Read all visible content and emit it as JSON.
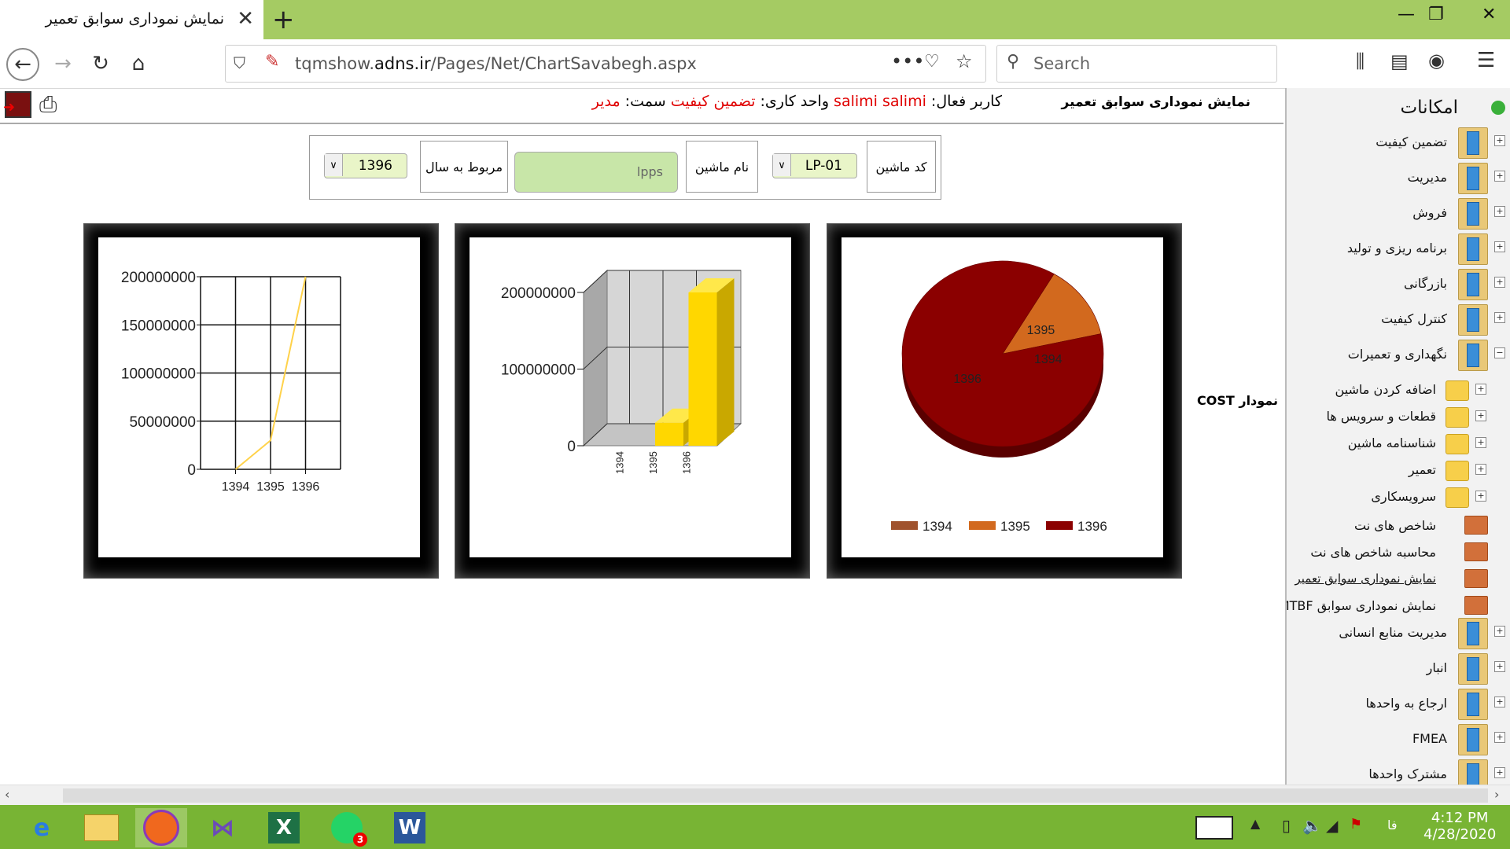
{
  "browser": {
    "tab_title": "نمایش نموداری سوابق تعمیر",
    "url_prefix": "tqmshow.",
    "url_domain": "adns.ir",
    "url_path": "/Pages/Net/ChartSavabegh.aspx",
    "search_placeholder": "Search"
  },
  "header": {
    "page_title": "نمایش نموداری سوابق تعمیر",
    "user_label": "کاربر فعال:",
    "user_value": "salimi salimi",
    "unit_label": "واحد کاری:",
    "unit_value": "تضمین کیفیت",
    "role_label": "سمت:",
    "role_value": "مدیر"
  },
  "filter": {
    "machine_code_label": "کد ماشین",
    "machine_code_value": "LP-01",
    "machine_name_label": "نام ماشین",
    "machine_name_value": "lpps",
    "year_label": "مربوط به سال",
    "year_value": "1396"
  },
  "chart_title": "نمودار COST",
  "sidebar": {
    "title": "امکانات",
    "items": [
      {
        "label": "تضمین کیفیت",
        "level": 0,
        "expander": "+"
      },
      {
        "label": "مدیریت",
        "level": 0,
        "expander": "+"
      },
      {
        "label": "فروش",
        "level": 0,
        "expander": "+"
      },
      {
        "label": "برنامه ریزی و تولید",
        "level": 0,
        "expander": "+"
      },
      {
        "label": "بازرگانی",
        "level": 0,
        "expander": "+"
      },
      {
        "label": "کنترل کیفیت",
        "level": 0,
        "expander": "+"
      },
      {
        "label": "نگهداری و تعمیرات",
        "level": 0,
        "expander": "−"
      },
      {
        "label": "اضافه کردن ماشین",
        "level": 1,
        "expander": "+"
      },
      {
        "label": "قطعات و سرویس ها",
        "level": 1,
        "expander": "+"
      },
      {
        "label": "شناسنامه ماشین",
        "level": 1,
        "expander": "+"
      },
      {
        "label": "تعمیر",
        "level": 1,
        "expander": "+"
      },
      {
        "label": "سرویسکاری",
        "level": 1,
        "expander": "+"
      },
      {
        "label": "شاخص های نت",
        "level": 2,
        "expander": ""
      },
      {
        "label": "محاسبه شاخص های نت",
        "level": 2,
        "expander": ""
      },
      {
        "label": "نمایش نموداری سوابق تعمیر",
        "level": 2,
        "expander": "",
        "active": true
      },
      {
        "label": "نمایش نموداری سوابق MTBF",
        "level": 2,
        "expander": ""
      },
      {
        "label": "مدیریت منابع انسانی",
        "level": 0,
        "expander": "+"
      },
      {
        "label": "انبار",
        "level": 0,
        "expander": "+"
      },
      {
        "label": "ارجاع به واحدها",
        "level": 0,
        "expander": "+"
      },
      {
        "label": "FMEA",
        "level": 0,
        "expander": "+"
      },
      {
        "label": "مشترک واحدها",
        "level": 0,
        "expander": "+"
      }
    ]
  },
  "taskbar": {
    "time": "4:12 PM",
    "date": "4/28/2020",
    "lang": "فا",
    "whatsapp_badge": "3"
  },
  "chart_data": [
    {
      "type": "line",
      "categories": [
        "1394",
        "1395",
        "1396"
      ],
      "values": [
        0,
        30000000,
        200000000
      ],
      "ylim": [
        0,
        200000000
      ],
      "yticks": [
        "0",
        "50000000",
        "100000000",
        "150000000",
        "200000000"
      ],
      "color": "#ffd24a"
    },
    {
      "type": "bar",
      "categories": [
        "1394",
        "1395",
        "1396"
      ],
      "values": [
        0,
        30000000,
        200000000
      ],
      "ylim": [
        0,
        200000000
      ],
      "yticks": [
        "0",
        "100000000",
        "200000000"
      ],
      "color": "#ffd700"
    },
    {
      "type": "pie",
      "categories": [
        "1394",
        "1395",
        "1396"
      ],
      "values": [
        0,
        30000000,
        200000000
      ],
      "colors": [
        "#a0522d",
        "#d2691e",
        "#8b0000"
      ],
      "legend": "bottom"
    }
  ]
}
